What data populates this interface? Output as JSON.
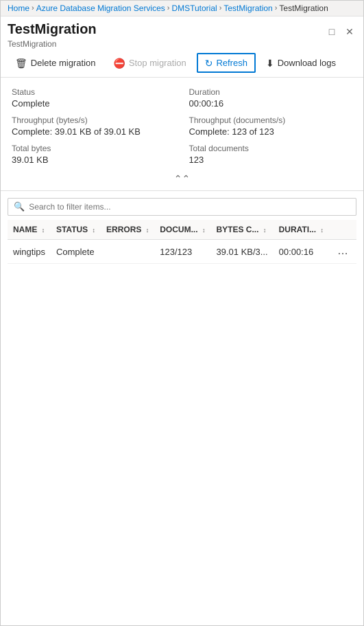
{
  "breadcrumb": {
    "items": [
      {
        "label": "Home",
        "link": true
      },
      {
        "label": "Azure Database Migration Services",
        "link": true
      },
      {
        "label": "DMSTutorial",
        "link": true
      },
      {
        "label": "TestMigration",
        "link": true
      },
      {
        "label": "TestMigration",
        "link": false
      }
    ],
    "separator": "›"
  },
  "header": {
    "title": "TestMigration",
    "subtitle": "TestMigration"
  },
  "toolbar": {
    "delete_label": "Delete migration",
    "stop_label": "Stop migration",
    "refresh_label": "Refresh",
    "download_label": "Download logs"
  },
  "stats": {
    "status_label": "Status",
    "status_value": "Complete",
    "duration_label": "Duration",
    "duration_value": "00:00:16",
    "throughput_bytes_label": "Throughput (bytes/s)",
    "throughput_bytes_value": "Complete: 39.01 KB of 39.01 KB",
    "throughput_docs_label": "Throughput (documents/s)",
    "throughput_docs_value": "Complete: 123 of 123",
    "total_bytes_label": "Total bytes",
    "total_bytes_value": "39.01 KB",
    "total_docs_label": "Total documents",
    "total_docs_value": "123"
  },
  "search": {
    "placeholder": "Search to filter items..."
  },
  "table": {
    "columns": [
      {
        "key": "name",
        "label": "NAME"
      },
      {
        "key": "status",
        "label": "STATUS"
      },
      {
        "key": "errors",
        "label": "ERRORS"
      },
      {
        "key": "documents",
        "label": "DOCUM..."
      },
      {
        "key": "bytes",
        "label": "BYTES C..."
      },
      {
        "key": "duration",
        "label": "DURATI..."
      }
    ],
    "rows": [
      {
        "name": "wingtips",
        "status": "Complete",
        "errors": "",
        "documents": "123/123",
        "bytes": "39.01 KB/3...",
        "duration": "00:00:16"
      }
    ]
  }
}
